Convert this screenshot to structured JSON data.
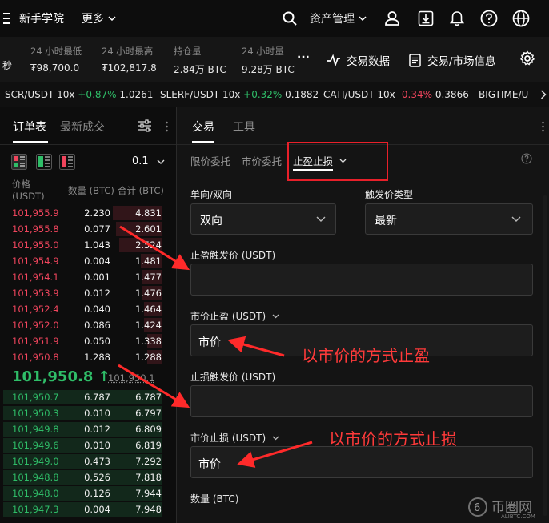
{
  "topbar": {
    "nav_partial": "秒",
    "learn": "新手学院",
    "more": "更多",
    "asset": "资产管理"
  },
  "stats": [
    {
      "label": "24 小时最低",
      "value": "₮98,700.0"
    },
    {
      "label": "24 小时最高",
      "value": "₮102,817.8"
    },
    {
      "label": "持仓量",
      "value": "2.84万 BTC"
    },
    {
      "label": "24 小时量",
      "value": "9.28万 BTC"
    }
  ],
  "stats_actions": {
    "more": "···",
    "trade_data": "交易数据",
    "market_info": "交易/市场信息"
  },
  "ticker": [
    {
      "name": "SCR/USDT 10x",
      "change": "+0.87%",
      "price": "1.0261",
      "dir": "up"
    },
    {
      "name": "SLERF/USDT 10x",
      "change": "+0.32%",
      "price": "0.1882",
      "dir": "up"
    },
    {
      "name": "CATI/USDT 10x",
      "change": "-0.34%",
      "price": "0.3866",
      "dir": "down"
    },
    {
      "name": "BIGTIME/U",
      "change": "",
      "price": "",
      "dir": "none"
    }
  ],
  "orderbook": {
    "tab_active": "订单表",
    "tab_inactive": "最新成交",
    "precision": "0.1",
    "col_price": "价格",
    "col_price_unit": "(USDT)",
    "col_qty": "数量 (BTC)",
    "col_total": "合计 (BTC)",
    "asks": [
      {
        "price": "101,955.9",
        "qty": "2.230",
        "total": "4.831",
        "depth": 0.31
      },
      {
        "price": "101,955.8",
        "qty": "0.077",
        "total": "2.601",
        "depth": 0.29
      },
      {
        "price": "101,955.0",
        "qty": "1.043",
        "total": "2.524",
        "depth": 0.27
      },
      {
        "price": "101,954.9",
        "qty": "0.004",
        "total": "1.481",
        "depth": 0.13
      },
      {
        "price": "101,954.1",
        "qty": "0.001",
        "total": "1.477",
        "depth": 0.12
      },
      {
        "price": "101,953.9",
        "qty": "0.012",
        "total": "1.476",
        "depth": 0.12
      },
      {
        "price": "101,952.4",
        "qty": "0.040",
        "total": "1.464",
        "depth": 0.11
      },
      {
        "price": "101,952.0",
        "qty": "0.086",
        "total": "1.424",
        "depth": 0.11
      },
      {
        "price": "101,951.9",
        "qty": "0.050",
        "total": "1.338",
        "depth": 0.09
      },
      {
        "price": "101,950.8",
        "qty": "1.288",
        "total": "1.288",
        "depth": 0.09
      }
    ],
    "last_price": "101,950.8 ↑",
    "mark_price": "101,950.1",
    "bids": [
      {
        "price": "101,950.7",
        "qty": "6.787",
        "total": "6.787",
        "depth": 1.0
      },
      {
        "price": "101,950.3",
        "qty": "0.010",
        "total": "6.797",
        "depth": 1.0
      },
      {
        "price": "101,949.8",
        "qty": "0.012",
        "total": "6.809",
        "depth": 1.0
      },
      {
        "price": "101,949.6",
        "qty": "0.010",
        "total": "6.819",
        "depth": 1.0
      },
      {
        "price": "101,949.0",
        "qty": "0.473",
        "total": "7.292",
        "depth": 1.0
      },
      {
        "price": "101,948.8",
        "qty": "0.526",
        "total": "7.818",
        "depth": 1.0
      },
      {
        "price": "101,948.0",
        "qty": "0.126",
        "total": "7.944",
        "depth": 1.0
      },
      {
        "price": "101,947.3",
        "qty": "0.004",
        "total": "7.948",
        "depth": 1.0
      }
    ]
  },
  "trade": {
    "tab_active": "交易",
    "tab_inactive": "工具",
    "order_types": [
      "限价委托",
      "市价委托",
      "止盈止损"
    ],
    "mode_label": "单向/双向",
    "mode_value": "双向",
    "trigger_type_label": "触发价类型",
    "trigger_type_value": "最新",
    "tp_trigger_label": "止盈触发价 (USDT)",
    "tp_market_label": "市价止盈 (USDT)",
    "tp_market_value": "市价",
    "sl_trigger_label": "止损触发价 (USDT)",
    "sl_market_label": "市价止损 (USDT)",
    "sl_market_value": "市价",
    "qty_label": "数量 (BTC)"
  },
  "annotations": {
    "tp_note": "以市价的方式止盈",
    "sl_note": "以市价的方式止损"
  },
  "watermark": {
    "name": "币圈网",
    "url": "ALIBTC.COM"
  },
  "colors": {
    "up": "#2fbd68",
    "down": "#f0455d",
    "annotation": "#ff3a3a"
  }
}
